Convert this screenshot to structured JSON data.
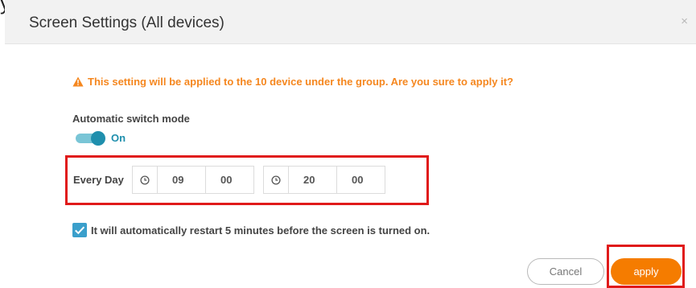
{
  "top_fragment": "y",
  "modal": {
    "title": "Screen Settings (All devices)",
    "close_glyph": "×"
  },
  "warning": {
    "icon": "warning-triangle-icon",
    "text": "This setting will be applied to the 10 device under the group. Are you sure to apply it?",
    "color": "#f5871f"
  },
  "auto_switch": {
    "label": "Automatic switch mode",
    "state_text": "On",
    "enabled": true,
    "accent": "#1f8fad"
  },
  "schedule": {
    "repeat_label": "Every Day",
    "on_time": {
      "hour": "09",
      "minute": "00"
    },
    "off_time": {
      "hour": "20",
      "minute": "00"
    }
  },
  "restart_option": {
    "checked": true,
    "text": "It will automatically restart 5 minutes before the screen is turned on."
  },
  "buttons": {
    "cancel": "Cancel",
    "apply": "apply",
    "apply_color": "#f57c00"
  },
  "highlight_color": "#e01a1a"
}
